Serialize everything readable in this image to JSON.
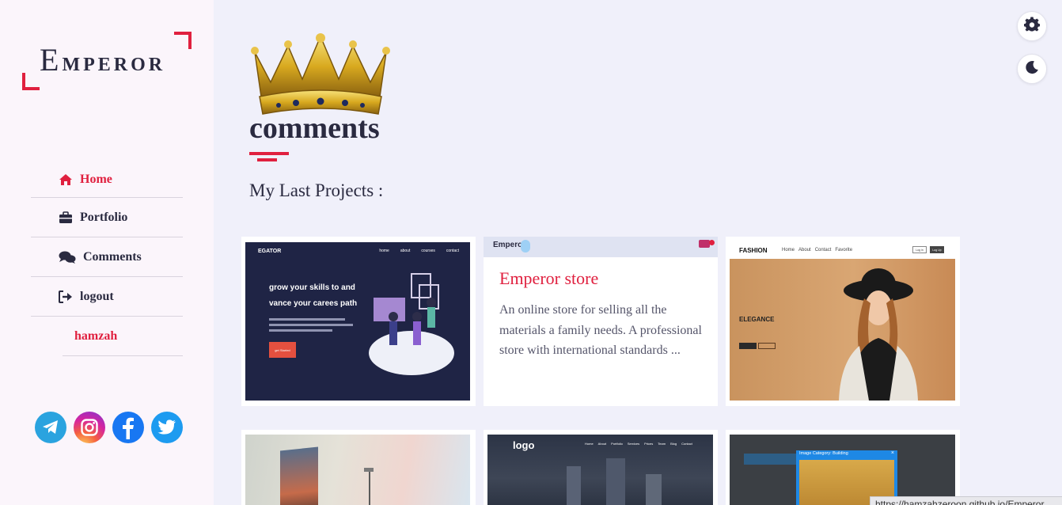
{
  "sidebar": {
    "logo_big": "E",
    "logo_rest": "MPEROR",
    "nav": [
      {
        "label": "Home",
        "icon": "home-icon",
        "active": true
      },
      {
        "label": "Portfolio",
        "icon": "briefcase-icon"
      },
      {
        "label": "Comments",
        "icon": "comments-icon"
      },
      {
        "label": "logout",
        "icon": "sign-out-icon"
      }
    ],
    "user": "hamzah",
    "socials": [
      "telegram-icon",
      "instagram-icon",
      "facebook-icon",
      "twitter-icon"
    ]
  },
  "main": {
    "title": "comments",
    "subtitle": "My Last Projects :"
  },
  "projects": [
    {
      "shot": {
        "brand": "EGATOR",
        "nav": [
          "home",
          "about",
          "courses",
          "contact"
        ],
        "headline1": "grow your skills to and",
        "headline2": "vance your carees path",
        "cta": "get Started"
      }
    },
    {
      "bar_brand": "Emperc",
      "title": "Emperor store",
      "desc": "An online store for selling all the materials a family needs. A professional store with international standards ..."
    },
    {
      "shot": {
        "brand": "FASHION",
        "nav": [
          "Home",
          "About",
          "Contact",
          "Favorite"
        ],
        "tagline": "ELEGANCE",
        "btn1": "Log in",
        "btn2": "Log Up"
      }
    },
    {
      "shot": {}
    },
    {
      "shot": {
        "brand": "logo",
        "nav": [
          "Home",
          "About",
          "Portfolio",
          "Services",
          "Prices",
          "Team",
          "Blog",
          "Contact"
        ]
      }
    },
    {
      "shot": {
        "dialog_title": "Image Category: Building"
      }
    }
  ],
  "status_url": "https://hamzahzeroon.github.io/Emperor..."
}
